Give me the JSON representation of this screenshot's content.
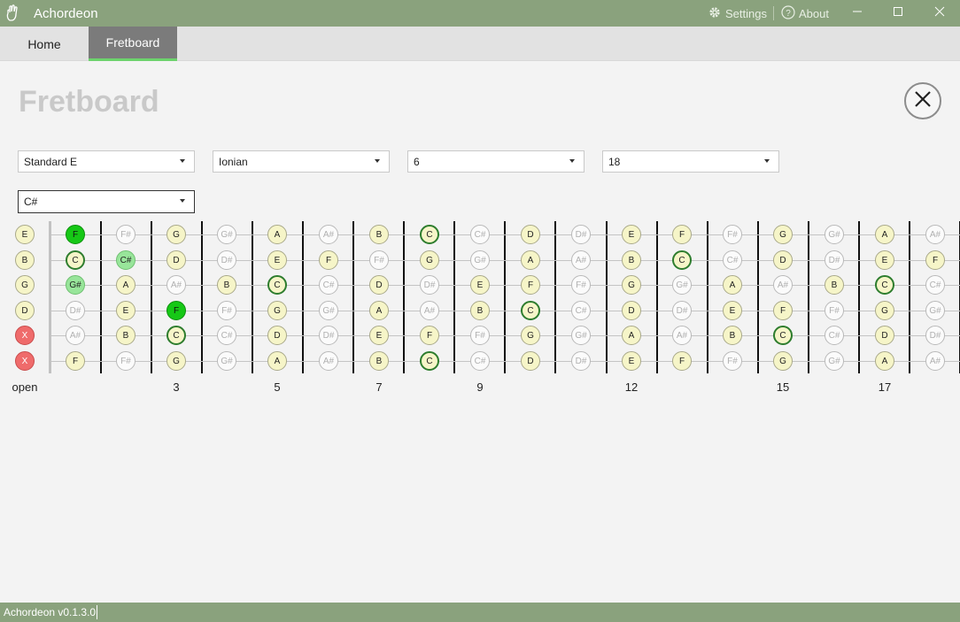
{
  "window": {
    "title": "Achordeon",
    "settings_label": "Settings",
    "about_label": "About"
  },
  "tabs": [
    {
      "label": "Home",
      "active": false
    },
    {
      "label": "Fretboard",
      "active": true
    }
  ],
  "page": {
    "title": "Fretboard"
  },
  "controls": {
    "tuning": "Standard E",
    "mode": "Ionian",
    "position": "6",
    "frets": "18",
    "root": "C#"
  },
  "fretboard": {
    "open_label": "open",
    "fret_markers": [
      "3",
      "5",
      "7",
      "9",
      "12",
      "15",
      "17"
    ],
    "strings": [
      {
        "open": "E",
        "open_state": "scale",
        "notes": [
          [
            "F",
            "chord"
          ],
          [
            "F#",
            "off"
          ],
          [
            "G",
            "scale"
          ],
          [
            "G#",
            "off"
          ],
          [
            "A",
            "scale"
          ],
          [
            "A#",
            "off"
          ],
          [
            "B",
            "scale"
          ],
          [
            "C",
            "root"
          ],
          [
            "C#",
            "off"
          ],
          [
            "D",
            "scale"
          ],
          [
            "D#",
            "off"
          ],
          [
            "E",
            "scale"
          ],
          [
            "F",
            "scale"
          ],
          [
            "F#",
            "off"
          ],
          [
            "G",
            "scale"
          ],
          [
            "G#",
            "off"
          ],
          [
            "A",
            "scale"
          ],
          [
            "A#",
            "off"
          ]
        ]
      },
      {
        "open": "B",
        "open_state": "scale",
        "notes": [
          [
            "C",
            "root"
          ],
          [
            "C#",
            "chordlite"
          ],
          [
            "D",
            "scale"
          ],
          [
            "D#",
            "off"
          ],
          [
            "E",
            "scale"
          ],
          [
            "F",
            "scale"
          ],
          [
            "F#",
            "off"
          ],
          [
            "G",
            "scale"
          ],
          [
            "G#",
            "off"
          ],
          [
            "A",
            "scale"
          ],
          [
            "A#",
            "off"
          ],
          [
            "B",
            "scale"
          ],
          [
            "C",
            "root"
          ],
          [
            "C#",
            "off"
          ],
          [
            "D",
            "scale"
          ],
          [
            "D#",
            "off"
          ],
          [
            "E",
            "scale"
          ],
          [
            "F",
            "scale"
          ]
        ]
      },
      {
        "open": "G",
        "open_state": "scale",
        "notes": [
          [
            "G#",
            "chordlite"
          ],
          [
            "A",
            "scale"
          ],
          [
            "A#",
            "off"
          ],
          [
            "B",
            "scale"
          ],
          [
            "C",
            "root"
          ],
          [
            "C#",
            "off"
          ],
          [
            "D",
            "scale"
          ],
          [
            "D#",
            "off"
          ],
          [
            "E",
            "scale"
          ],
          [
            "F",
            "scale"
          ],
          [
            "F#",
            "off"
          ],
          [
            "G",
            "scale"
          ],
          [
            "G#",
            "off"
          ],
          [
            "A",
            "scale"
          ],
          [
            "A#",
            "off"
          ],
          [
            "B",
            "scale"
          ],
          [
            "C",
            "root"
          ],
          [
            "C#",
            "off"
          ]
        ]
      },
      {
        "open": "D",
        "open_state": "scale",
        "notes": [
          [
            "D#",
            "off"
          ],
          [
            "E",
            "scale"
          ],
          [
            "F",
            "chord"
          ],
          [
            "F#",
            "off"
          ],
          [
            "G",
            "scale"
          ],
          [
            "G#",
            "off"
          ],
          [
            "A",
            "scale"
          ],
          [
            "A#",
            "off"
          ],
          [
            "B",
            "scale"
          ],
          [
            "C",
            "root"
          ],
          [
            "C#",
            "off"
          ],
          [
            "D",
            "scale"
          ],
          [
            "D#",
            "off"
          ],
          [
            "E",
            "scale"
          ],
          [
            "F",
            "scale"
          ],
          [
            "F#",
            "off"
          ],
          [
            "G",
            "scale"
          ],
          [
            "G#",
            "off"
          ]
        ]
      },
      {
        "open": "X",
        "open_state": "muted",
        "notes": [
          [
            "A#",
            "off"
          ],
          [
            "B",
            "scale"
          ],
          [
            "C",
            "root"
          ],
          [
            "C#",
            "off"
          ],
          [
            "D",
            "scale"
          ],
          [
            "D#",
            "off"
          ],
          [
            "E",
            "scale"
          ],
          [
            "F",
            "scale"
          ],
          [
            "F#",
            "off"
          ],
          [
            "G",
            "scale"
          ],
          [
            "G#",
            "off"
          ],
          [
            "A",
            "scale"
          ],
          [
            "A#",
            "off"
          ],
          [
            "B",
            "scale"
          ],
          [
            "C",
            "root"
          ],
          [
            "C#",
            "off"
          ],
          [
            "D",
            "scale"
          ],
          [
            "D#",
            "off"
          ]
        ]
      },
      {
        "open": "X",
        "open_state": "muted",
        "notes": [
          [
            "F",
            "scale"
          ],
          [
            "F#",
            "off"
          ],
          [
            "G",
            "scale"
          ],
          [
            "G#",
            "off"
          ],
          [
            "A",
            "scale"
          ],
          [
            "A#",
            "off"
          ],
          [
            "B",
            "scale"
          ],
          [
            "C",
            "root"
          ],
          [
            "C#",
            "off"
          ],
          [
            "D",
            "scale"
          ],
          [
            "D#",
            "off"
          ],
          [
            "E",
            "scale"
          ],
          [
            "F",
            "scale"
          ],
          [
            "F#",
            "off"
          ],
          [
            "G",
            "scale"
          ],
          [
            "G#",
            "off"
          ],
          [
            "A",
            "scale"
          ],
          [
            "A#",
            "off"
          ]
        ]
      }
    ]
  },
  "status": {
    "version": "Achordeon v0.1.3.0"
  }
}
